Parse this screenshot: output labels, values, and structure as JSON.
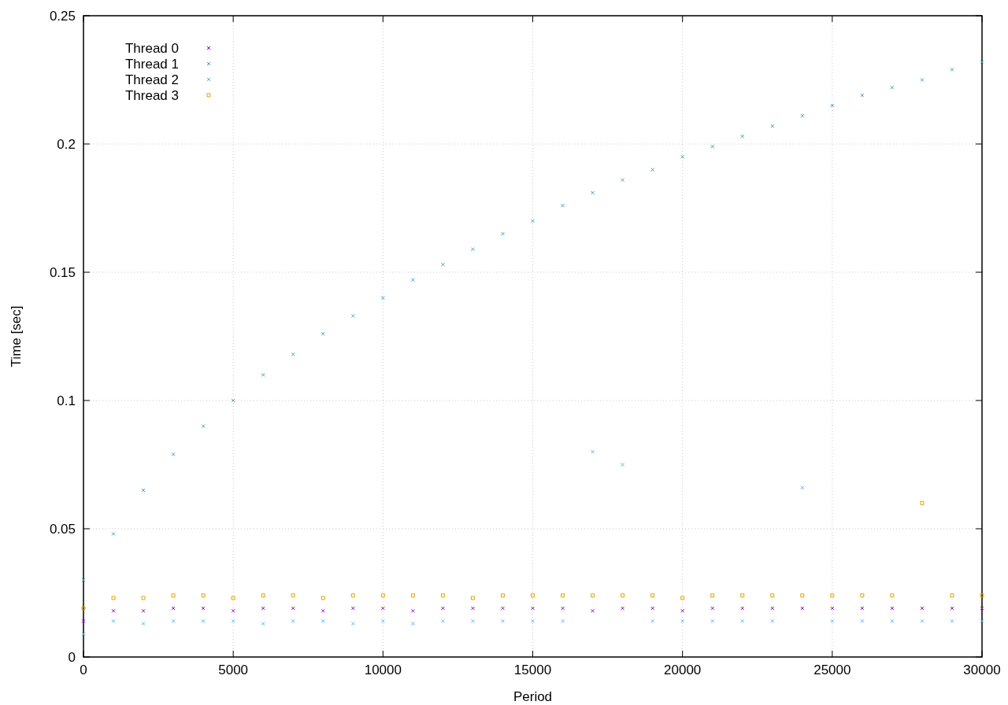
{
  "chart_data": {
    "type": "scatter",
    "xlabel": "Period",
    "ylabel": "Time [sec]",
    "xlim": [
      0,
      30000
    ],
    "ylim": [
      0,
      0.25
    ],
    "xticks": [
      0,
      5000,
      10000,
      15000,
      20000,
      25000,
      30000
    ],
    "yticks": [
      0,
      0.05,
      0.1,
      0.15,
      0.2,
      0.25
    ],
    "grid": true,
    "legend": true,
    "x": [
      0,
      1000,
      2000,
      3000,
      4000,
      5000,
      6000,
      7000,
      8000,
      9000,
      10000,
      11000,
      12000,
      13000,
      14000,
      15000,
      16000,
      17000,
      18000,
      19000,
      20000,
      21000,
      22000,
      23000,
      24000,
      25000,
      26000,
      27000,
      28000,
      29000,
      30000
    ],
    "series": [
      {
        "name": "Thread 0",
        "color": "#9400d3",
        "values": [
          0.014,
          0.018,
          0.018,
          0.019,
          0.019,
          0.018,
          0.019,
          0.019,
          0.018,
          0.019,
          0.019,
          0.018,
          0.019,
          0.019,
          0.019,
          0.019,
          0.019,
          0.018,
          0.019,
          0.019,
          0.018,
          0.019,
          0.019,
          0.019,
          0.019,
          0.019,
          0.019,
          0.019,
          0.019,
          0.019,
          0.019
        ]
      },
      {
        "name": "Thread 1",
        "color": "#3aa0c8",
        "values": [
          0.03,
          0.048,
          0.065,
          0.079,
          0.09,
          0.1,
          0.11,
          0.118,
          0.126,
          0.133,
          0.14,
          0.147,
          0.153,
          0.159,
          0.165,
          0.17,
          0.176,
          0.181,
          0.186,
          0.19,
          0.195,
          0.199,
          0.203,
          0.207,
          0.211,
          0.215,
          0.219,
          0.222,
          0.225,
          0.229,
          0.232
        ]
      },
      {
        "name": "Thread 2",
        "color": "#56b4e9",
        "values": [
          0.009,
          0.014,
          0.013,
          0.014,
          0.014,
          0.014,
          0.013,
          0.014,
          0.014,
          0.013,
          0.014,
          0.013,
          0.014,
          0.014,
          0.014,
          0.014,
          0.014,
          0.08,
          0.075,
          0.014,
          0.014,
          0.014,
          0.014,
          0.014,
          0.066,
          0.014,
          0.014,
          0.014,
          0.014,
          0.014,
          0.014
        ]
      },
      {
        "name": "Thread 3",
        "color": "#e69f00",
        "values": [
          0.019,
          0.023,
          0.023,
          0.024,
          0.024,
          0.023,
          0.024,
          0.024,
          0.023,
          0.024,
          0.024,
          0.024,
          0.024,
          0.023,
          0.024,
          0.024,
          0.024,
          0.024,
          0.024,
          0.024,
          0.023,
          0.024,
          0.024,
          0.024,
          0.024,
          0.024,
          0.024,
          0.024,
          0.06,
          0.024,
          0.024
        ]
      }
    ]
  }
}
